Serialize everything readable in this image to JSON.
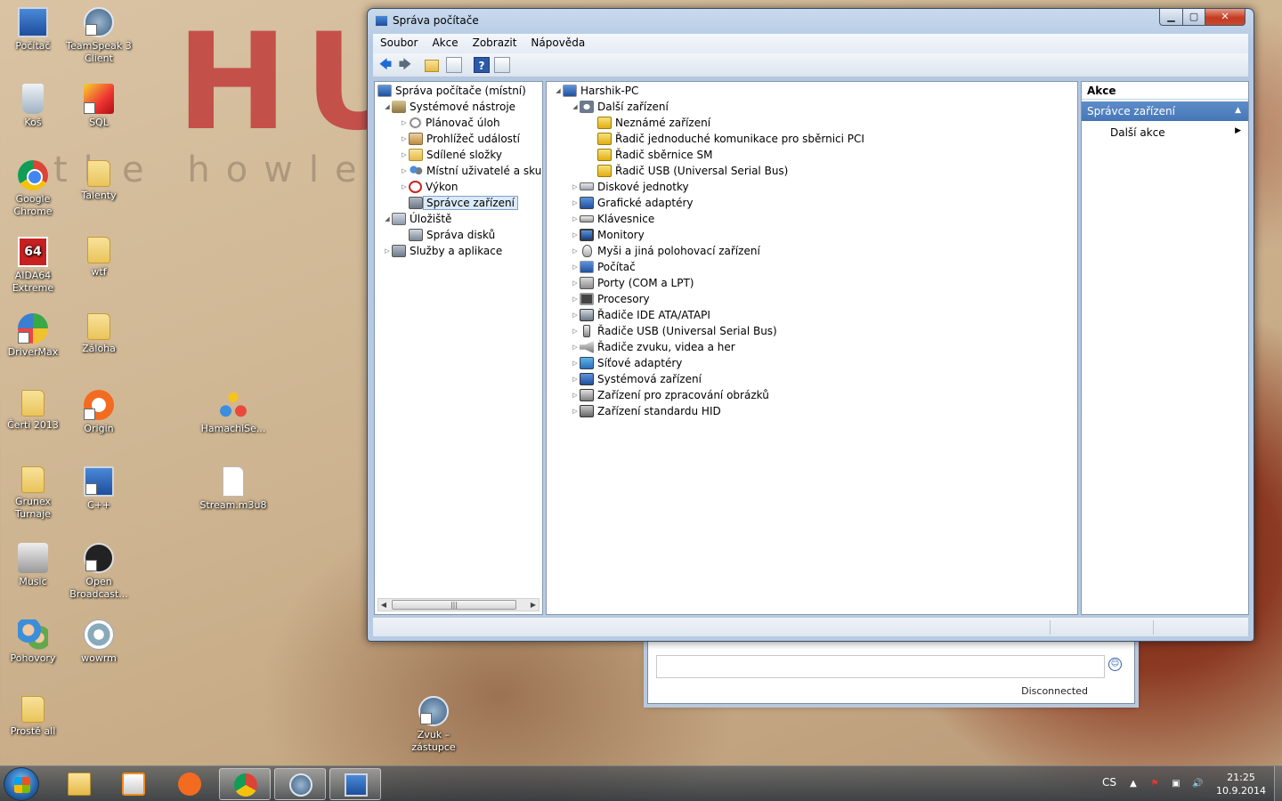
{
  "wallpaper": {
    "big_text": "HUN",
    "sub_text": "the howler"
  },
  "desktop_icons": [
    {
      "label": "Počítač",
      "icon": "computer-icon"
    },
    {
      "label": "TeamSpeak 3 Client",
      "icon": "teamspeak-icon"
    },
    {
      "label": "Koš",
      "icon": "recycle-bin-icon"
    },
    {
      "label": "SQL",
      "icon": "sql-icon"
    },
    {
      "label": "Google Chrome",
      "icon": "chrome-icon"
    },
    {
      "label": "Talenty",
      "icon": "folder-icon"
    },
    {
      "label": "AIDA64 Extreme",
      "icon": "aida64-icon"
    },
    {
      "label": "wtf",
      "icon": "folder-icon"
    },
    {
      "label": "DriverMax",
      "icon": "drivermax-icon"
    },
    {
      "label": "Záloha",
      "icon": "folder-icon"
    },
    {
      "label": "Čerti 2013",
      "icon": "folder-icon"
    },
    {
      "label": "Origin",
      "icon": "origin-icon"
    },
    {
      "label": "HamachiSe...",
      "icon": "hamachi-icon"
    },
    {
      "label": "Grunex Turnaje",
      "icon": "folder-icon"
    },
    {
      "label": "C++",
      "icon": "cpp-icon"
    },
    {
      "label": "Stream.m3u8",
      "icon": "file-icon"
    },
    {
      "label": "Music",
      "icon": "music-icon"
    },
    {
      "label": "Open Broadcast...",
      "icon": "obs-icon"
    },
    {
      "label": "Pohovory",
      "icon": "people-icon"
    },
    {
      "label": "wowrm",
      "icon": "settings-file-icon"
    },
    {
      "label": "Prostě all",
      "icon": "folder-icon"
    },
    {
      "label": "Zvuk – zástupce",
      "icon": "sound-shortcut-icon"
    }
  ],
  "chat_window": {
    "status": "Disconnected"
  },
  "window": {
    "title": "Správa počítače",
    "menu": [
      "Soubor",
      "Akce",
      "Zobrazit",
      "Nápověda"
    ],
    "tree": {
      "root": "Správa počítače (místní)",
      "system_tools": "Systémové nástroje",
      "task_scheduler": "Plánovač úloh",
      "event_viewer": "Prohlížeč událostí",
      "shared_folders": "Sdílené složky",
      "local_users": "Místní uživatelé a skupiny",
      "performance": "Výkon",
      "device_manager": "Správce zařízení",
      "storage": "Úložiště",
      "disk_management": "Správa disků",
      "services": "Služby a aplikace"
    },
    "devices": {
      "computer": "Harshik-PC",
      "other_devices": "Další zařízení",
      "other_children": [
        "Neznámé zařízení",
        "Řadič jednoduché komunikace pro sběrnici PCI",
        "Řadič sběrnice SM",
        "Řadič USB (Universal Serial Bus)"
      ],
      "categories": [
        "Diskové jednotky",
        "Grafické adaptéry",
        "Klávesnice",
        "Monitory",
        "Myši a jiná polohovací zařízení",
        "Počítač",
        "Porty (COM a LPT)",
        "Procesory",
        "Řadiče IDE ATA/ATAPI",
        "Řadiče USB (Universal Serial Bus)",
        "Řadiče zvuku, videa a her",
        "Síťové adaptéry",
        "Systémová zařízení",
        "Zařízení pro zpracování obrázků",
        "Zařízení standardu HID"
      ]
    },
    "actions": {
      "header": "Akce",
      "section": "Správce zařízení",
      "more": "Další akce"
    }
  },
  "taskbar": {
    "language": "CS",
    "time": "21:25",
    "date": "10.9.2014"
  }
}
